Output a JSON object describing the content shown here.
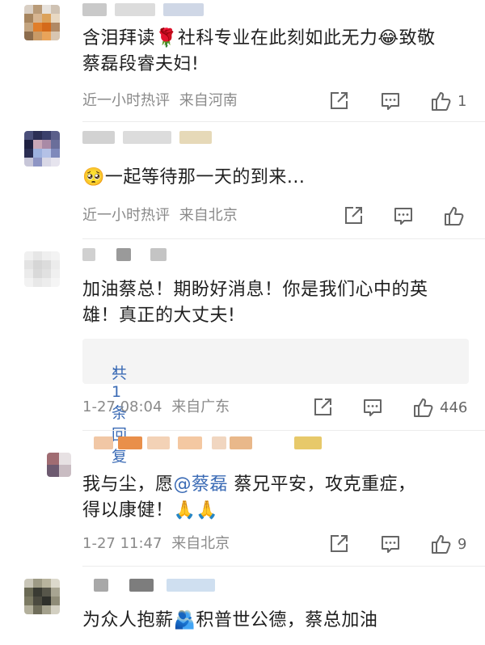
{
  "comments": [
    {
      "text_a": "含泪拜读🌹社科专业在此刻如此无力😂致敬",
      "text_b": "蔡磊段睿夫妇!",
      "time": "近一小时热评",
      "location": "来自河南",
      "likes": "1"
    },
    {
      "text": "🥺一起等待那一天的到来...",
      "time": "近一小时热评",
      "location": "来自北京",
      "likes": ""
    },
    {
      "text_a": "加油蔡总！期盼好消息！你是我们心中的英",
      "text_b": "雄！真正的大丈夫!",
      "reply_label": "共1条回复",
      "time": "1-27 08:04",
      "location": "来自广东",
      "likes": "446"
    },
    {
      "text_a_prefix": "我与尘，愿",
      "mention": "@蔡磊",
      "text_a_suffix": " 蔡兄平安，攻克重症，",
      "text_b": "得以康健！🙏🙏",
      "time": "1-27 11:47",
      "location": "来自北京",
      "likes": "9"
    },
    {
      "text": "为众人抱薪🫂积普世公德，蔡总加油"
    }
  ],
  "colors": {
    "link": "#3b6bb5",
    "meta": "#8a8a8a"
  }
}
